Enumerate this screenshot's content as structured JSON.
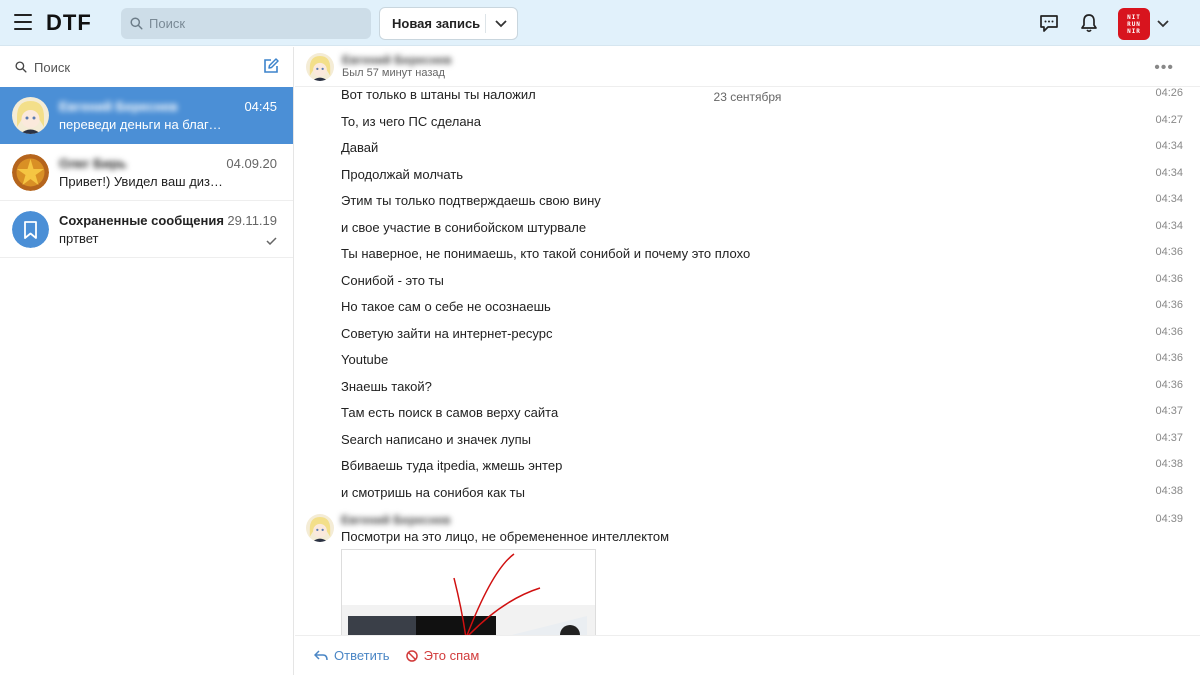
{
  "header": {
    "logo": "DTF",
    "search_placeholder": "Поиск",
    "new_post_label": "Новая запись",
    "avatar_text": [
      "NIT",
      "RUN",
      "NIR"
    ]
  },
  "sidebar": {
    "search_label": "Поиск",
    "chats": [
      {
        "name": "Евгений Береснев",
        "time": "04:45",
        "preview": "переведи деньги на благотворительность",
        "active": true
      },
      {
        "name": "Олег Бирь",
        "time": "04.09.20",
        "preview": "Привет!) Увидел ваш дизлайк",
        "active": false
      },
      {
        "name": "Сохраненные сообщения",
        "time": "29.11.19",
        "preview": "пртвет",
        "active": false
      }
    ]
  },
  "conversation": {
    "name": "Евгений Береснев",
    "status": "Был 57 минут назад",
    "date_separator": "23 сентября",
    "messages": [
      {
        "text": "Вот только в штаны ты наложил",
        "time": "04:26"
      },
      {
        "text": "То, из чего ПС сделана",
        "time": "04:27"
      },
      {
        "text": "Давай",
        "time": "04:34"
      },
      {
        "text": "Продолжай молчать",
        "time": "04:34"
      },
      {
        "text": "Этим ты только подтверждаешь свою вину",
        "time": "04:34"
      },
      {
        "text": "и свое участие в сонибойском штурвале",
        "time": "04:34"
      },
      {
        "text": "Ты наверное, не понимаешь, кто такой сонибой и почему это плохо",
        "time": "04:36"
      },
      {
        "text": "Сонибой - это ты",
        "time": "04:36"
      },
      {
        "text": "Но такое сам о себе не осознаешь",
        "time": "04:36"
      },
      {
        "text": "Советую зайти на интернет-ресурс",
        "time": "04:36"
      },
      {
        "text": "Youtube",
        "time": "04:36"
      },
      {
        "text": "Знаешь такой?",
        "time": "04:36"
      },
      {
        "text": "Там есть поиск в самов верху сайта",
        "time": "04:37"
      },
      {
        "text": "Search написано и значек лупы",
        "time": "04:37"
      },
      {
        "text": "Вбиваешь туда itpedia, жмешь энтер",
        "time": "04:38"
      },
      {
        "text": "и смотришь на сонибоя как ты",
        "time": "04:38"
      }
    ],
    "last_group": {
      "name": "Евгений Береснев",
      "time": "04:39",
      "text": "Посмотри на это лицо, не обремененное интеллектом"
    }
  },
  "footer": {
    "reply_label": "Ответить",
    "spam_label": "Это спам"
  },
  "colors": {
    "header_bg": "#e1f1fb",
    "active_chat": "#4b8fd6",
    "reply": "#4a86c5",
    "spam": "#d23c3c"
  }
}
